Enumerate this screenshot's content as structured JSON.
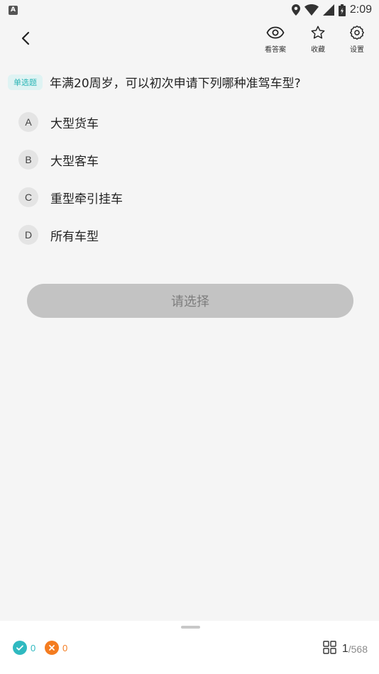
{
  "status_bar": {
    "app_icon_letter": "A",
    "time": "2:09"
  },
  "header": {
    "actions": [
      {
        "label": "看答案",
        "icon": "eye-icon"
      },
      {
        "label": "收藏",
        "icon": "star-icon"
      },
      {
        "label": "设置",
        "icon": "gear-icon"
      }
    ]
  },
  "question": {
    "type_tag": "单选题",
    "text": "年满20周岁，可以初次申请下列哪种准驾车型?"
  },
  "options": [
    {
      "letter": "A",
      "text": "大型货车"
    },
    {
      "letter": "B",
      "text": "大型客车"
    },
    {
      "letter": "C",
      "text": "重型牵引挂车"
    },
    {
      "letter": "D",
      "text": "所有车型"
    }
  ],
  "submit_label": "请选择",
  "bottom": {
    "correct_count": "0",
    "wrong_count": "0",
    "current": "1",
    "total": "/568"
  },
  "colors": {
    "accent": "#2bb6b6",
    "correct": "#2fb9c0",
    "wrong": "#f47c20",
    "button_disabled": "#c3c3c3"
  }
}
